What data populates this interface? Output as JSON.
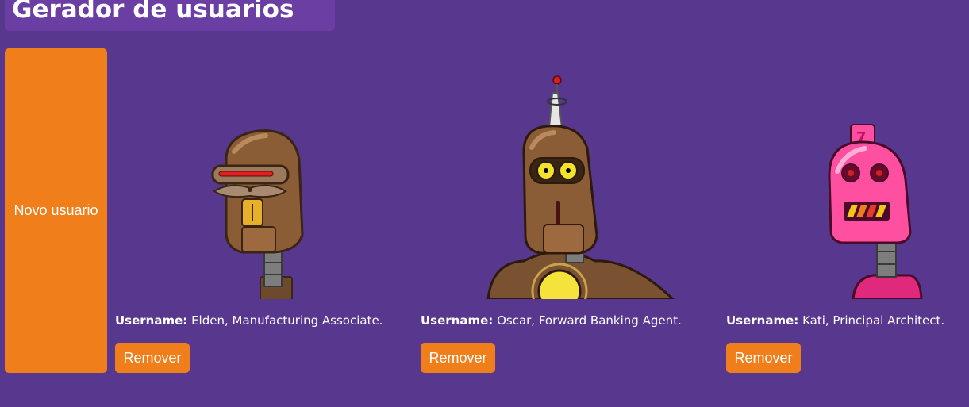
{
  "header": {
    "title": "Gerador de usuarios"
  },
  "actions": {
    "new_user_label": "Novo usuario"
  },
  "users": [
    {
      "username_label": "Username:",
      "description": "Elden, Manufacturing Associate.",
      "remove_label": "Remover",
      "avatar_icon": "brown-robot-mustache-avatar"
    },
    {
      "username_label": "Username:",
      "description": "Oscar, Forward Banking Agent.",
      "remove_label": "Remover",
      "avatar_icon": "brown-robot-antenna-avatar"
    },
    {
      "username_label": "Username:",
      "description": "Kati, Principal Architect.",
      "remove_label": "Remover",
      "avatar_icon": "pink-robot-avatar"
    }
  ],
  "colors": {
    "background": "#58378e",
    "header_bg": "#6a3ea3",
    "button": "#f07e1a",
    "text": "#ffffff"
  }
}
